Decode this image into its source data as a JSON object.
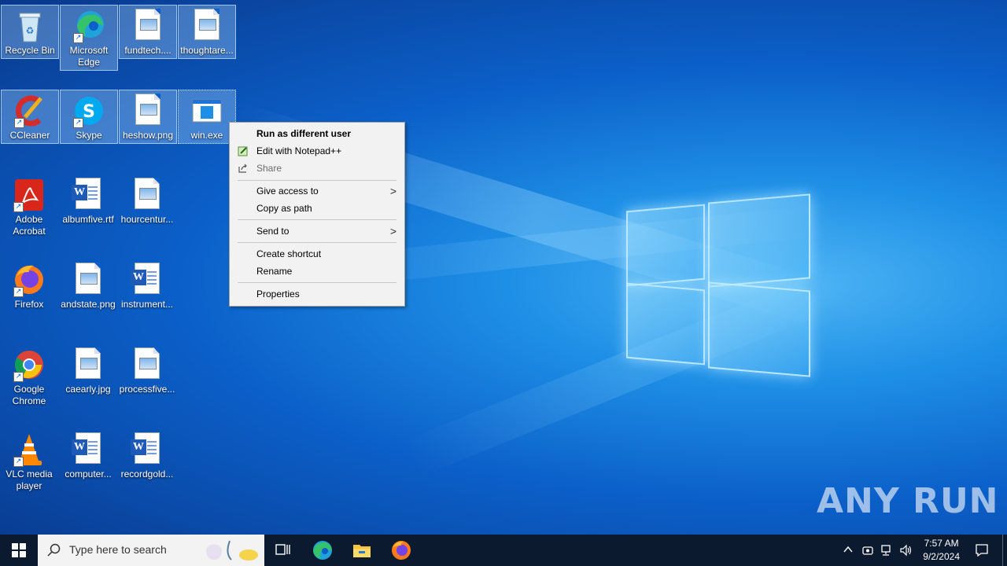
{
  "desktop_icons": [
    {
      "label": "Recycle Bin"
    },
    {
      "label": "Microsoft Edge"
    },
    {
      "label": "fundtech...."
    },
    {
      "label": "thoughtare..."
    },
    {
      "label": "CCleaner"
    },
    {
      "label": "Skype"
    },
    {
      "label": "heshow.png"
    },
    {
      "label": "win.exe"
    },
    {
      "label": "Adobe Acrobat"
    },
    {
      "label": "albumfive.rtf"
    },
    {
      "label": "hourcentur..."
    },
    {
      "label": "Firefox"
    },
    {
      "label": "andstate.png"
    },
    {
      "label": "instrument..."
    },
    {
      "label": "Google Chrome"
    },
    {
      "label": "caearly.jpg"
    },
    {
      "label": "processfive..."
    },
    {
      "label": "VLC media player"
    },
    {
      "label": "computer..."
    },
    {
      "label": "recordgold..."
    }
  ],
  "context_menu": {
    "items": [
      {
        "label": "Run as different user"
      },
      {
        "label": "Edit with Notepad++"
      },
      {
        "label": "Share"
      },
      {
        "label": "Give access to"
      },
      {
        "label": "Copy as path"
      },
      {
        "label": "Send to"
      },
      {
        "label": "Create shortcut"
      },
      {
        "label": "Rename"
      },
      {
        "label": "Properties"
      }
    ],
    "submenu_arrow": ">"
  },
  "watermark": "ANY RUN",
  "taskbar": {
    "search_placeholder": "Type here to search",
    "time": "7:57 AM",
    "date": "9/2/2024"
  }
}
